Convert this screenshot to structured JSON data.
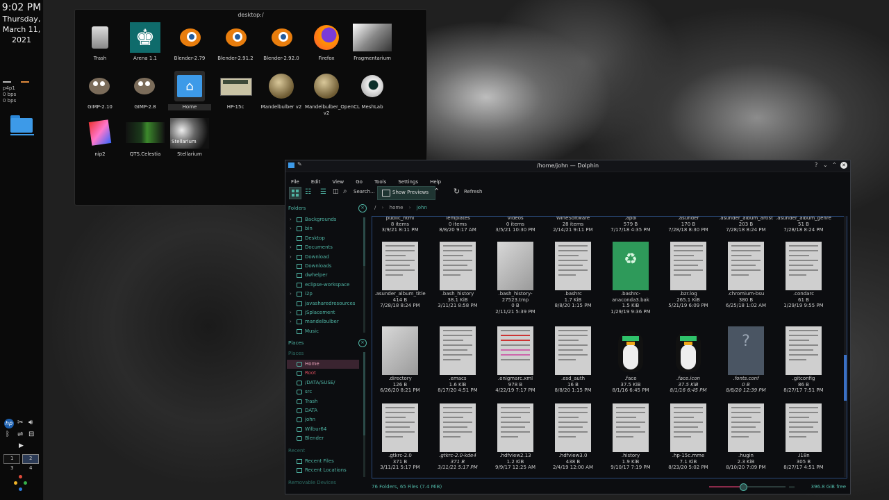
{
  "panel": {
    "time": "9:02 PM",
    "day": "Thursday,",
    "date": "March 11,",
    "year": "2021",
    "net_iface": "p4p1",
    "net_rx": "0 bps",
    "net_tx": "0 bps",
    "pager": [
      "1",
      "2",
      "3",
      "4"
    ]
  },
  "desktop_window": {
    "title": "desktop:/",
    "icons": [
      {
        "label": "Trash",
        "icon": "trash-icon"
      },
      {
        "label": "Arena 1.1",
        "icon": "chess-king-icon"
      },
      {
        "label": "Blender-2.79",
        "icon": "blender-icon"
      },
      {
        "label": "Blender-2.91.2",
        "icon": "blender-icon"
      },
      {
        "label": "Blender-2.92.0",
        "icon": "blender-icon"
      },
      {
        "label": "Firefox",
        "icon": "firefox-icon"
      },
      {
        "label": "Fragmentarium",
        "icon": "fragmentarium-icon"
      },
      {
        "label": "GIMP-2.10",
        "icon": "gimp-icon"
      },
      {
        "label": "GIMP-2.8",
        "icon": "gimp-icon"
      },
      {
        "label": "Home",
        "icon": "home-folder-icon"
      },
      {
        "label": "HP-15c",
        "icon": "calculator-icon"
      },
      {
        "label": "Mandelbulber v2",
        "icon": "mandelbulber-icon"
      },
      {
        "label": "Mandelbulber_OpenCL v2",
        "icon": "mandelbulber-icon"
      },
      {
        "label": "MeshLab",
        "icon": "meshlab-icon"
      },
      {
        "label": "nip2",
        "icon": "nip2-icon"
      },
      {
        "label": "QTS.Celestia",
        "icon": "celestia-icon"
      },
      {
        "label": "Stellarium",
        "icon": "stellarium-icon"
      }
    ]
  },
  "dolphin": {
    "title": "/home/john — Dolphin",
    "menu": [
      "File",
      "Edit",
      "View",
      "Go",
      "Tools",
      "Settings",
      "Help"
    ],
    "toolbar": {
      "search": "Search...",
      "show_previews": "Show Previews",
      "refresh": "Refresh"
    },
    "breadcrumb": [
      "/",
      "home",
      "john"
    ],
    "folders_header": "Folders",
    "folders": [
      "Backgrounds",
      "bin",
      "Desktop",
      "Documents",
      "Download",
      "Downloads",
      "dwhelper",
      "eclipse-workspace",
      "i2p",
      "javasharedresources",
      "jSplacement",
      "mandelbulber",
      "Music"
    ],
    "places_header": "Places",
    "places_section": "Places",
    "places": [
      "Home",
      "Root",
      "/DATA/SUSE/",
      "src",
      "Trash",
      "DATA",
      "john",
      "Wilbur64",
      "Blender"
    ],
    "recent_section": "Recent",
    "recent": [
      "Recent Files",
      "Recent Locations"
    ],
    "removable_section": "Removable Devices",
    "top_row": [
      {
        "name": "public_html",
        "size": "8 items",
        "date": "3/9/21 8:11 PM"
      },
      {
        "name": "Templates",
        "size": "0 items",
        "date": "8/8/20 9:17 AM"
      },
      {
        "name": "Videos",
        "size": "0 items",
        "date": "3/5/21 10:30 PM"
      },
      {
        "name": "WineSoftware",
        "size": "28 items",
        "date": "2/14/21 9:11 PM"
      },
      {
        "name": ".apol",
        "size": "579 B",
        "date": "7/17/18 4:35 PM"
      },
      {
        "name": ".asunder",
        "size": "170 B",
        "date": "7/28/18 8:30 PM"
      },
      {
        "name": ".asunder_album_artist",
        "size": "203 B",
        "date": "7/28/18 8:24 PM"
      },
      {
        "name": ".asunder_album_genre",
        "size": "51 B",
        "date": "7/28/18 8:24 PM"
      }
    ],
    "row2": [
      {
        "name": ".asunder_album_title",
        "size": "414 B",
        "date": "7/28/18 8:24 PM"
      },
      {
        "name": ".bash_history",
        "size": "38.1 KiB",
        "date": "3/11/21 8:58 PM"
      },
      {
        "name": ".bash_history-27523.tmp",
        "size": "0 B",
        "date": "2/11/21 5:39 PM"
      },
      {
        "name": ".bashrc",
        "size": "1.7 KiB",
        "date": "8/8/20 1:15 PM"
      },
      {
        "name": ".bashrc-anaconda3.bak",
        "size": "1.5 KiB",
        "date": "1/29/19 9:36 PM"
      },
      {
        "name": ".bzr.log",
        "size": "265.1 KiB",
        "date": "5/21/19 6:09 PM"
      },
      {
        "name": ".chromium-bsu",
        "size": "380 B",
        "date": "6/25/18 1:02 AM"
      },
      {
        "name": ".condarc",
        "size": "61 B",
        "date": "1/29/19 9:55 PM"
      }
    ],
    "row3": [
      {
        "name": ".directory",
        "size": "126 B",
        "date": "6/26/20 8:21 PM"
      },
      {
        "name": ".emacs",
        "size": "1.6 KiB",
        "date": "8/17/20 4:51 PM"
      },
      {
        "name": ".enigmarc.xml",
        "size": "978 B",
        "date": "4/22/19 7:17 PM"
      },
      {
        "name": ".esd_auth",
        "size": "16 B",
        "date": "8/8/20 1:15 PM"
      },
      {
        "name": ".face",
        "size": "37.5 KiB",
        "date": "8/1/16 6:45 PM"
      },
      {
        "name": ".face.icon",
        "size": "37.5 KiB",
        "date": "8/1/16 6:45 PM"
      },
      {
        "name": ".fonts.conf",
        "size": "0 B",
        "date": "8/8/20 12:39 PM"
      },
      {
        "name": ".gitconfig",
        "size": "86 B",
        "date": "8/27/17 7:51 PM"
      }
    ],
    "row4": [
      {
        "name": ".gtkrc-2.0",
        "size": "371 B",
        "date": "3/11/21 5:17 PM"
      },
      {
        "name": ".gtkrc-2.0-kde4",
        "size": "371 B",
        "date": "3/11/21 5:17 PM"
      },
      {
        "name": ".hdfview2.13",
        "size": "1.2 KiB",
        "date": "9/9/17 12:25 AM"
      },
      {
        "name": ".hdfview3.0",
        "size": "438 B",
        "date": "2/4/19 12:00 AM"
      },
      {
        "name": ".history",
        "size": "1.9 KiB",
        "date": "9/10/17 7:19 PM"
      },
      {
        "name": ".hp-15c.mme",
        "size": "7.1 KiB",
        "date": "8/23/20 5:02 PM"
      },
      {
        "name": ".hugin",
        "size": "2.3 KiB",
        "date": "8/10/20 7:09 PM"
      },
      {
        "name": ".i18n",
        "size": "305 B",
        "date": "8/27/17 4:51 PM"
      }
    ],
    "status": "76 Folders, 65 Files (7.4 MiB)",
    "free": "396.8 GiB free"
  }
}
